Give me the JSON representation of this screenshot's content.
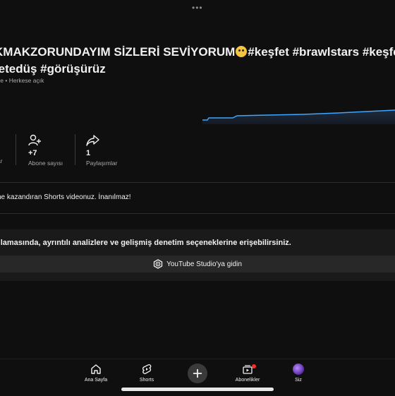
{
  "top_handle": "•••",
  "video": {
    "title_line1": "KMAKZORUNDAYIM SİZLERİ SEVİYORUM",
    "title_line1_tags": "#keşfet #brawlstars #keşfetbe",
    "title_line2": "fetedüş #görüşürüz",
    "meta_prefix": "ce",
    "meta_separator": "•",
    "visibility": "Herkese açık"
  },
  "stats": [
    {
      "value": "",
      "label": "ar"
    },
    {
      "value": "+7",
      "label": "Abone sayısı"
    },
    {
      "value": "1",
      "label": "Paylaşımlar"
    }
  ],
  "achievement_text": "ne kazandıran Shorts videonuz. İnanılmaz!",
  "studio": {
    "description": "ulamasında, ayrıntılı analizlere ve gelişmiş denetim seçeneklerine erişebilirsiniz.",
    "button_label": "YouTube Studio'ya gidin"
  },
  "nav": {
    "home": "Ana Sayfa",
    "shorts": "Shorts",
    "subscriptions": "Abonelikler",
    "you": "Siz"
  },
  "colors": {
    "accent_line": "#3ea6ff",
    "notification_badge": "#ff2b2b"
  }
}
